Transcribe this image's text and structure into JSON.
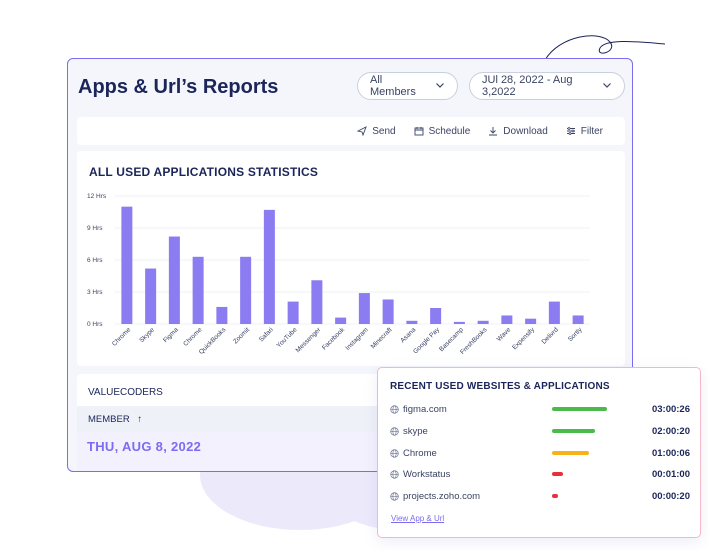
{
  "header": {
    "title": "Apps & Url’s Reports",
    "members_select": "All Members",
    "date_range": "JUl 28, 2022 - Aug 3,2022"
  },
  "toolbar": {
    "send": "Send",
    "schedule": "Schedule",
    "download": "Download",
    "filter": "Filter"
  },
  "chart_data": {
    "type": "bar",
    "title": "ALL USED APPLICATIONS STATISTICS",
    "categories": [
      "Chrome",
      "Skype",
      "Figma",
      "Chrome",
      "QuickBooks",
      "Zoomit",
      "Safari",
      "YouTube",
      "Messenger",
      "Facebook",
      "Instagram",
      "Minecraft",
      "Asana",
      "Google Pay",
      "Basecamp",
      "FreshBooks",
      "Wave",
      "Expensify",
      "Delivrd",
      "Sortly"
    ],
    "values": [
      11.0,
      5.2,
      8.2,
      6.3,
      1.6,
      6.3,
      10.7,
      2.1,
      4.1,
      0.6,
      2.9,
      2.3,
      0.3,
      1.5,
      0.2,
      0.3,
      0.8,
      0.5,
      2.1,
      0.8
    ],
    "y_ticks": [
      "0 Hrs",
      "3 Hrs",
      "6 Hrs",
      "9 Hrs",
      "12 Hrs"
    ],
    "ylim": [
      0,
      12
    ],
    "grid": true,
    "bar_color": "#8b7cf2"
  },
  "member_table": {
    "group": "VALUECODERS",
    "column": "MEMBER",
    "sort_icon": "↑",
    "date": "THU, AUG 8, 2022"
  },
  "recent": {
    "title": "RECENT USED WEBSITES & APPLICATIONS",
    "items": [
      {
        "name": "figma.com",
        "time": "03:00:26",
        "level": 1.0,
        "color": "#4cba4a"
      },
      {
        "name": "skype",
        "time": "02:00:20",
        "level": 0.78,
        "color": "#4cba4a"
      },
      {
        "name": "Chrome",
        "time": "01:00:06",
        "level": 0.67,
        "color": "#f7b21a"
      },
      {
        "name": "Workstatus",
        "time": "00:01:00",
        "level": 0.2,
        "color": "#e8303d"
      },
      {
        "name": "projects.zoho.com",
        "time": "00:00:20",
        "level": 0.1,
        "color": "#e8303d"
      }
    ],
    "link": "View App & Url"
  }
}
